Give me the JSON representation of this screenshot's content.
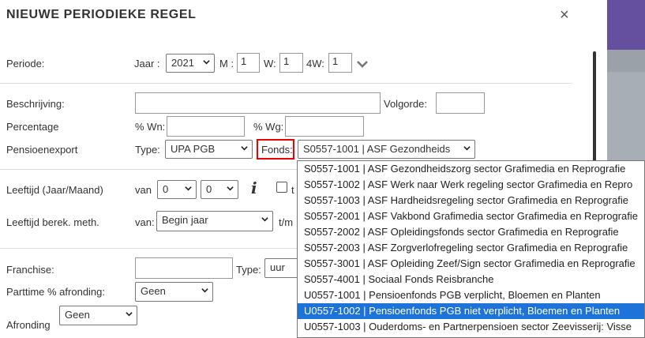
{
  "dialog": {
    "title": "NIEUWE PERIODIEKE REGEL",
    "close": "×"
  },
  "periode": {
    "label": "Periode:",
    "jaar_label": "Jaar :",
    "jaar_value": "2021",
    "m_label": "M :",
    "m_value": "1",
    "w_label": "W:",
    "w_value": "1",
    "w4_label": "4W:",
    "w4_value": "1"
  },
  "beschrijving": {
    "label": "Beschrijving:",
    "value": "",
    "volgorde_label": "Volgorde:",
    "volgorde_value": ""
  },
  "percentage": {
    "label": "Percentage",
    "wn_label": "% Wn:",
    "wn_value": "",
    "wg_label": "% Wg:",
    "wg_value": ""
  },
  "pensioenexport": {
    "label": "Pensioenexport",
    "type_label": "Type:",
    "type_value": "UPA PGB",
    "fonds_label": "Fonds:",
    "fonds_value": "S0557-1001 | ASF Gezondheids"
  },
  "leeftijd": {
    "label": "Leeftijd (Jaar/Maand)",
    "van_label": "van",
    "jaar_value": "0",
    "maand_value": "0",
    "info_icon": "i",
    "t_text": "t"
  },
  "leeftijd_berek": {
    "label": "Leeftijd berek. meth.",
    "van_label": "van:",
    "value": "Begin jaar",
    "tm_label": "t/m"
  },
  "franchise": {
    "label": "Franchise:",
    "value": "",
    "type_label": "Type:",
    "type_value": "uur"
  },
  "parttime": {
    "label": "Parttime % afronding:",
    "value": "Geen"
  },
  "afronding": {
    "label": "Afronding",
    "value": "Geen"
  },
  "fonds_options": [
    "S0557-1001 | ASF Gezondheidszorg sector Grafimedia en Reprografie",
    "S0557-1002 | ASF Werk naar Werk regeling sector Grafimedia en Repro",
    "S0557-1003 | ASF Hardheidsregeling sector Grafimedia en Reprografie",
    "S0557-2001 | ASF Vakbond Grafimedia sector Grafimedia en Reprografie",
    "S0557-2002 | ASF Opleidingsfonds sector Grafimedia en Reprografie",
    "S0557-2003 | ASF Zorgverlofregeling sector Grafimedia en Reprografie",
    "S0557-3001 | ASF Opleiding Zeef/Sign sector Grafimedia en Reprografie",
    "S0557-4001 | Sociaal Fonds Reisbranche",
    "U0557-1001 | Pensioenfonds PGB verplicht, Bloemen en Planten",
    "U0557-1002 | Pensioenfonds PGB niet verplicht, Bloemen en Planten",
    "U0557-1003 | Ouderdoms- en Partnerpensioen sector Zeevisserij: Visse"
  ],
  "selected_option_index": 9
}
